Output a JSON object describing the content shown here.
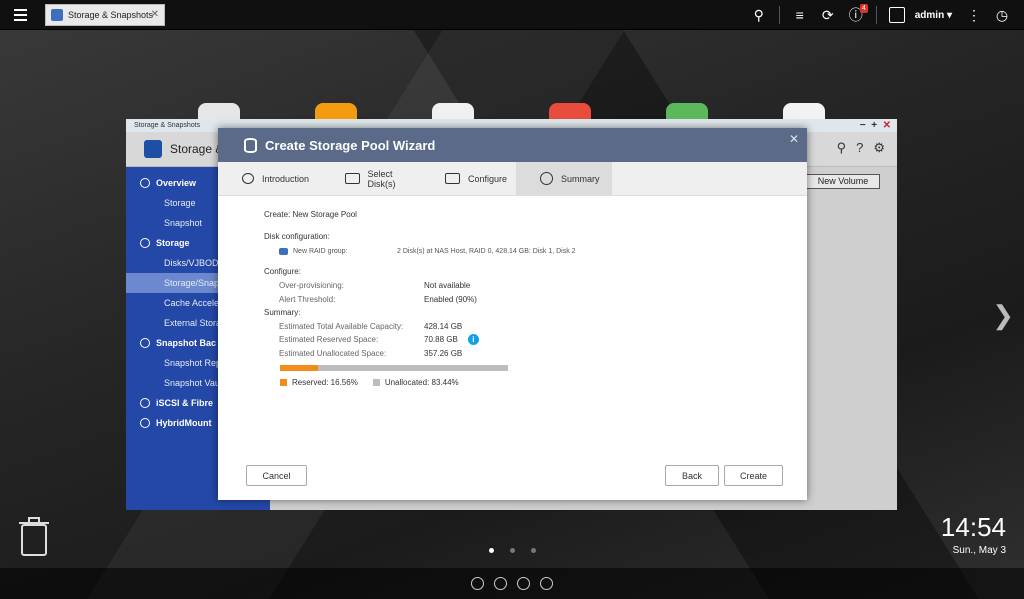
{
  "taskbar": {
    "tab_label": "Storage & Snapshots",
    "notifications_count": "4",
    "user": "admin"
  },
  "bg_window": {
    "title": "Storage & Snapshots",
    "header": "Storage &",
    "new_volume": "New Volume",
    "sidebar": [
      {
        "label": "Overview",
        "kind": "sec"
      },
      {
        "label": "Storage",
        "kind": "sub"
      },
      {
        "label": "Snapshot",
        "kind": "sub"
      },
      {
        "label": "Storage",
        "kind": "sec"
      },
      {
        "label": "Disks/VJBOD",
        "kind": "sub"
      },
      {
        "label": "Storage/Snap",
        "kind": "sub act"
      },
      {
        "label": "Cache Acceler",
        "kind": "sub"
      },
      {
        "label": "External Stora",
        "kind": "sub"
      },
      {
        "label": "Snapshot Bac",
        "kind": "sec"
      },
      {
        "label": "Snapshot Rep",
        "kind": "sub"
      },
      {
        "label": "Snapshot Vau",
        "kind": "sub"
      },
      {
        "label": "iSCSI & Fibre",
        "kind": "sec"
      },
      {
        "label": "HybridMount",
        "kind": "sec"
      }
    ]
  },
  "wizard": {
    "title": "Create Storage Pool Wizard",
    "steps": [
      "Introduction",
      "Select Disk(s)",
      "Configure",
      "Summary"
    ],
    "create_line": "Create: New Storage Pool",
    "disk_config_label": "Disk configuration:",
    "raid_key": "New RAID group:",
    "raid_value": "2 Disk(s) at NAS Host, RAID 0, 428.14 GB: Disk 1, Disk 2",
    "configure_label": "Configure:",
    "overprov_label": "Over-provisioning:",
    "overprov_value": "Not available",
    "alert_label": "Alert Threshold:",
    "alert_value": "Enabled (90%)",
    "summary_label": "Summary:",
    "total_label": "Estimated Total Available Capacity:",
    "total_value": "428.14 GB",
    "reserved_label": "Estimated Reserved Space:",
    "reserved_value": "70.88 GB",
    "unalloc_label": "Estimated Unallocated Space:",
    "unalloc_value": "357.26 GB",
    "reserved_fraction": 0.1656,
    "legend_reserved": "Reserved: 16.56%",
    "legend_unalloc": "Unallocated: 83.44%",
    "cancel": "Cancel",
    "back": "Back",
    "create": "Create"
  },
  "desktop": {
    "time": "14:54",
    "date": "Sun., May 3"
  },
  "colors": {
    "accent": "#f28c1a",
    "sidebar": "#2448a7",
    "wizard_title": "#5b6a88",
    "info": "#12a0e8"
  }
}
